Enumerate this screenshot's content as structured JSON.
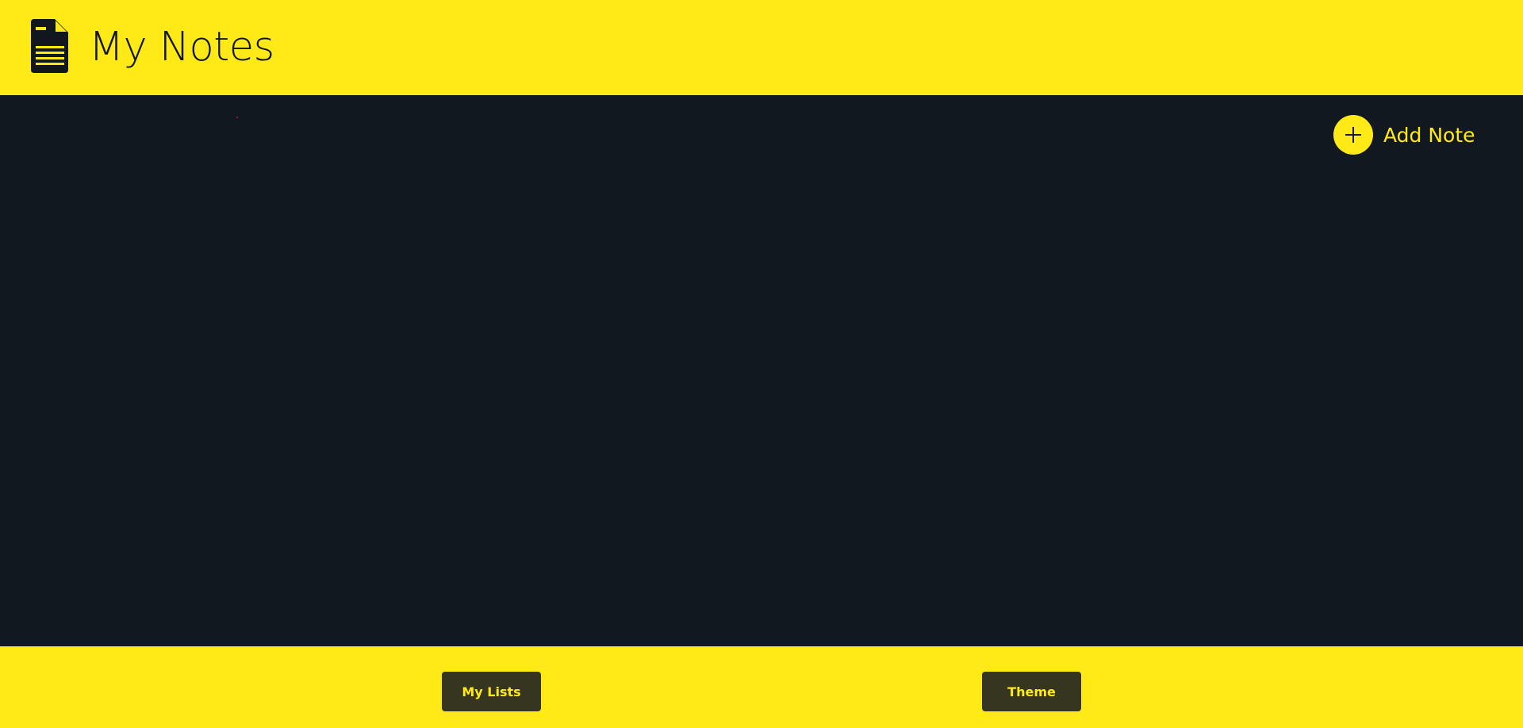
{
  "header": {
    "title": "My Notes",
    "icon": "document-icon"
  },
  "main": {
    "add_note_label": "Add Note",
    "add_icon": "plus-icon"
  },
  "footer": {
    "lists_label": "My Lists",
    "theme_label": "Theme"
  },
  "colors": {
    "accent": "#ffe917",
    "background": "#111820",
    "button_bg": "#353520",
    "text_dark": "#12171d"
  }
}
